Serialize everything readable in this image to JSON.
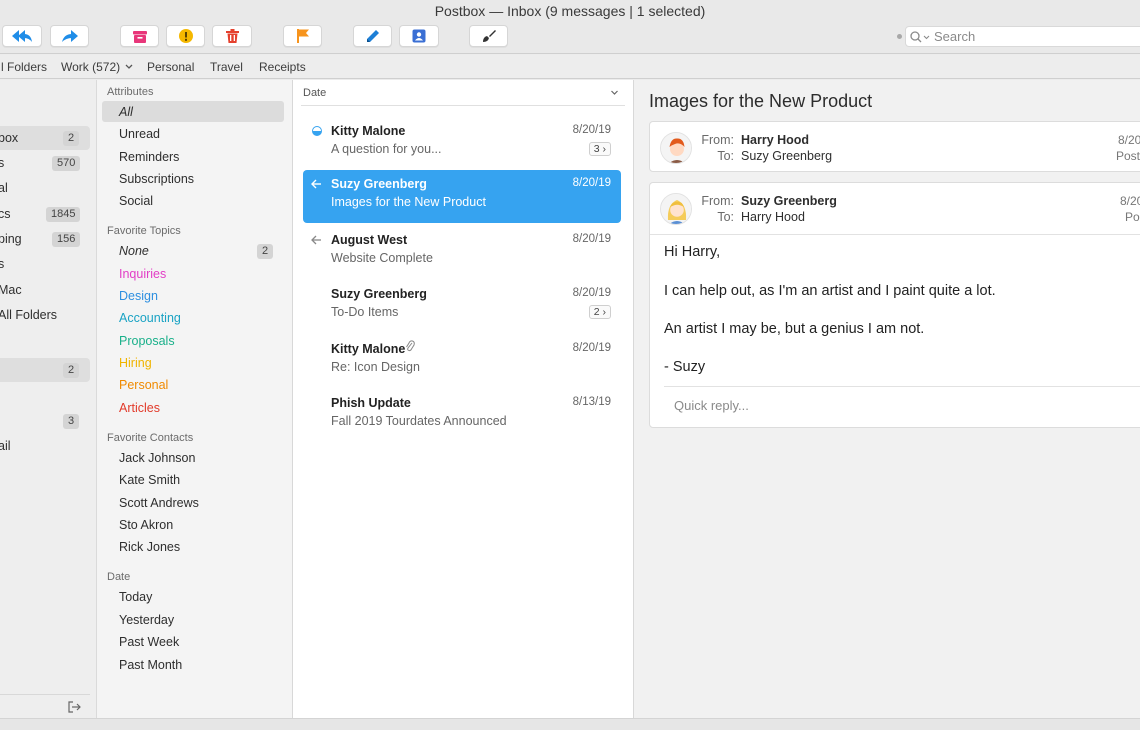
{
  "window": {
    "title": "Postbox — Inbox (9 messages | 1 selected)"
  },
  "toolbar": {
    "search_placeholder": "Search"
  },
  "tabs": [
    {
      "label": "l Folders"
    },
    {
      "label": "Work (572)"
    },
    {
      "label": "Personal"
    },
    {
      "label": "Travel"
    },
    {
      "label": "Receipts"
    }
  ],
  "folders": [
    {
      "label": "box",
      "count": "2"
    },
    {
      "label": "s",
      "count": "570"
    },
    {
      "label": "al",
      "count": ""
    },
    {
      "label": "cs",
      "count": "1845"
    },
    {
      "label": "ping",
      "count": "156"
    },
    {
      "label": "s",
      "count": ""
    },
    {
      "label": "Mac",
      "count": ""
    },
    {
      "label": "All Folders",
      "count": ""
    },
    {
      "label": "",
      "count": "2"
    },
    {
      "label": "",
      "count": "3"
    },
    {
      "label": "ail",
      "count": ""
    }
  ],
  "topics": {
    "attributes_heading": "Attributes",
    "attributes": [
      "All",
      "Unread",
      "Reminders",
      "Subscriptions",
      "Social"
    ],
    "favorite_topics_heading": "Favorite Topics",
    "favorite_topics": [
      {
        "label": "None",
        "count": "2",
        "color": "#2e2e2e"
      },
      {
        "label": "Inquiries",
        "color": "#e23ec6"
      },
      {
        "label": "Design",
        "color": "#2d8fe0"
      },
      {
        "label": "Accounting",
        "color": "#1aa3c4"
      },
      {
        "label": "Proposals",
        "color": "#19b08a"
      },
      {
        "label": "Hiring",
        "color": "#f0b400"
      },
      {
        "label": "Personal",
        "color": "#f08a00"
      },
      {
        "label": "Articles",
        "color": "#e23a2a"
      }
    ],
    "favorite_contacts_heading": "Favorite Contacts",
    "favorite_contacts": [
      "Jack Johnson",
      "Kate Smith",
      "Scott Andrews",
      "Sto Akron",
      "Rick Jones"
    ],
    "date_heading": "Date",
    "dates": [
      "Today",
      "Yesterday",
      "Past Week",
      "Past Month"
    ]
  },
  "message_list": {
    "sort_label": "Date",
    "messages": [
      {
        "from": "Kitty Malone",
        "subject": "A question for you...",
        "date": "8/20/19",
        "thread": "3"
      },
      {
        "from": "Suzy Greenberg",
        "subject": "Images for the New Product",
        "date": "8/20/19"
      },
      {
        "from": "August West",
        "subject": "Website Complete",
        "date": "8/20/19"
      },
      {
        "from": "Suzy Greenberg",
        "subject": "To-Do Items",
        "date": "8/20/19",
        "thread": "2"
      },
      {
        "from": "Kitty Malone",
        "subject": "Re: Icon Design",
        "date": "8/20/19"
      },
      {
        "from": "Phish Update",
        "subject": "Fall 2019 Tourdates Announced",
        "date": "8/13/19"
      }
    ]
  },
  "reading": {
    "subject": "Images for the New Product",
    "header1": {
      "from_label": "From:",
      "from": "Harry Hood",
      "to_label": "To:",
      "to": "Suzy Greenberg",
      "date": "8/20",
      "extra": "Post"
    },
    "header2": {
      "from_label": "From:",
      "from": "Suzy Greenberg",
      "to_label": "To:",
      "to": "Harry Hood",
      "date": "8/20",
      "extra": "Po"
    },
    "body": [
      "Hi Harry,",
      "I can help out, as I'm an artist and I paint quite a lot.",
      "An artist I may be, but a genius I am not.",
      "- Suzy"
    ],
    "quick_reply_placeholder": "Quick reply..."
  },
  "colors": {
    "accent": "#36a3f0",
    "reply_blue": "#1f8de8",
    "archive": "#e8367a",
    "warning": "#f5b800",
    "delete": "#e5412e",
    "flag": "#f7941d",
    "compose": "#1d7fd6",
    "contact": "#3a6fd4"
  }
}
